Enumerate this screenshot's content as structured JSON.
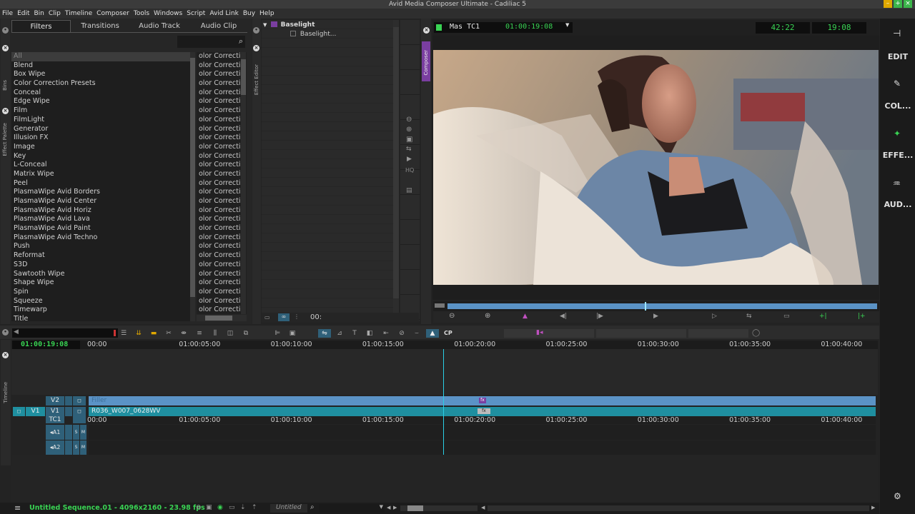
{
  "window": {
    "title": "Avid Media Composer Ultimate - Cadiliac 5"
  },
  "menu": [
    "File",
    "Edit",
    "Bin",
    "Clip",
    "Timeline",
    "Composer",
    "Tools",
    "Windows",
    "Script",
    "Avid Link",
    "Buy",
    "Help"
  ],
  "effect_palette": {
    "tabs": [
      "Filters",
      "Transitions",
      "Audio Track",
      "Audio Clip"
    ],
    "categories": [
      "All",
      "Blend",
      "Box Wipe",
      "Color Correction Presets",
      "Conceal",
      "Edge Wipe",
      "Film",
      "FilmLight",
      "Generator",
      "Illusion FX",
      "Image",
      "Key",
      "L-Conceal",
      "Matrix Wipe",
      "Peel",
      "PlasmaWipe Avid Borders",
      "PlasmaWipe Avid Center",
      "PlasmaWipe Avid Horiz",
      "PlasmaWipe Avid Lava",
      "PlasmaWipe Avid Paint",
      "PlasmaWipe Avid Techno",
      "Push",
      "Reformat",
      "S3D",
      "Sawtooth Wipe",
      "Shape Wipe",
      "Spin",
      "Squeeze",
      "Timewarp",
      "Title"
    ],
    "effects": [
      "olor Correctio",
      "olor Correctio",
      "olor Correctio",
      "olor Correctio",
      "olor Correctio",
      "olor Correctio",
      "olor Correctio",
      "olor Correctio",
      "olor Correctio",
      "olor Correctio",
      "olor Correctio",
      "olor Correctio",
      "olor Correctio",
      "olor Correctio",
      "olor Correctio",
      "olor Correctio",
      "olor Correctio",
      "olor Correctio",
      "olor Correctio",
      "olor Correctio",
      "olor Correctio",
      "olor Correctio",
      "olor Correctio",
      "olor Correctio",
      "olor Correctio",
      "olor Correctio",
      "olor Correctio",
      "olor Correctio",
      "olor Correctio"
    ],
    "side_tabs": {
      "bins": "Bins",
      "effect_palette": "Effect Palette"
    }
  },
  "effect_editor": {
    "side_tab": "Effect Editor",
    "tree_root": "Baselight",
    "tree_child": "Baselight...",
    "timecode": "00:",
    "hq_label": "HQ"
  },
  "composer": {
    "side_tab": "Composer",
    "source_label": "Mas TC1",
    "source_tc": "01:00:19:08",
    "counter1": "42:22",
    "counter2": "19:08",
    "playhead_fraction": 0.46
  },
  "right_sidebar": {
    "items": [
      "EDIT",
      "COL...",
      "EFFE...",
      "AUD..."
    ]
  },
  "timeline": {
    "side_tab": "Timeline",
    "timecode": "01:00:19:08",
    "cp_label": "CP",
    "ruler_labels": [
      "00:00",
      "01:00:05:00",
      "01:00:10:00",
      "01:00:15:00",
      "01:00:20:00",
      "01:00:25:00",
      "01:00:30:00",
      "01:00:35:00",
      "01:00:40:00"
    ],
    "ruler_labels_lower": [
      "00:00",
      "01:00:05:00",
      "01:00:10:00",
      "01:00:15:00",
      "01:00:20:00",
      "01:00:25:00",
      "01:00:30:00",
      "01:00:35:00",
      "01:00:40:00"
    ],
    "tracks": {
      "v2": "V2",
      "v1": "V1",
      "tc1": "TC1",
      "a1": "A1",
      "a2": "A2",
      "src_v1": "V1",
      "solo": "S",
      "mute": "M"
    },
    "clips": {
      "filler": "Filler",
      "v1_clip": "R036_W007_0628WV"
    },
    "status": "Untitled Sequence.01 - 4096x2160 - 23.98 fps",
    "bin_name": "Untitled"
  },
  "colors": {
    "accent_green": "#39d353",
    "purple": "#7a3ea0",
    "track_blue": "#5b93c6",
    "clip_teal": "#1f8fa0"
  }
}
